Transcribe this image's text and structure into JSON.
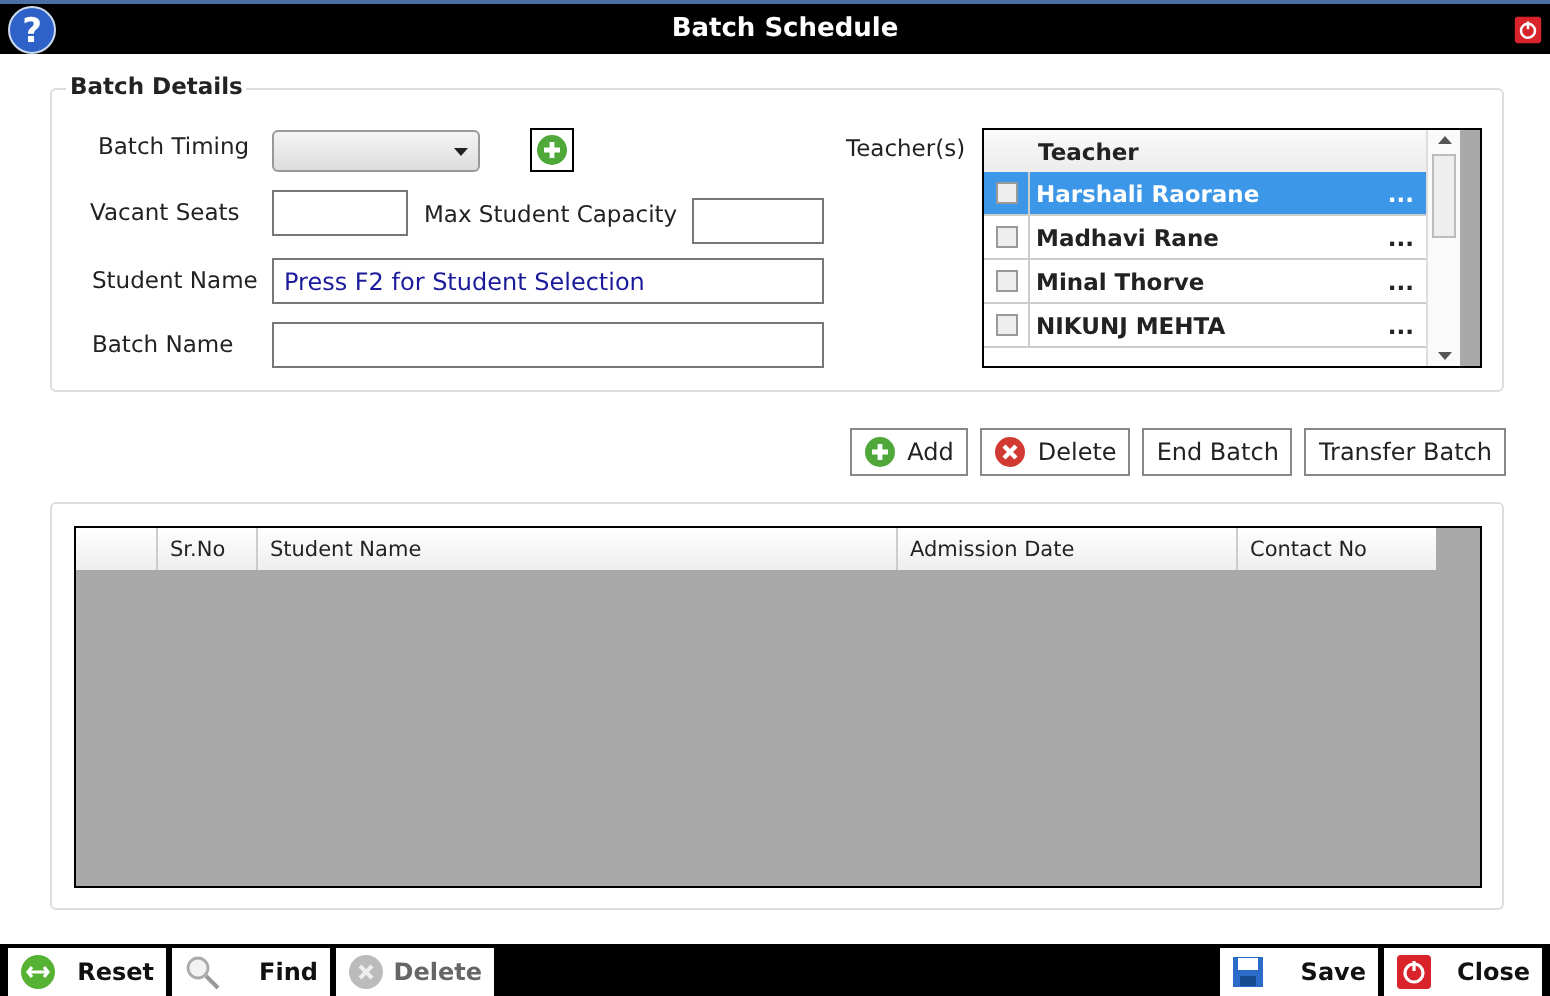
{
  "window": {
    "title": "Batch Schedule",
    "help": "?"
  },
  "batch_details": {
    "title": "Batch Details",
    "batch_timing": {
      "label": "Batch Timing"
    },
    "vacant_seats": {
      "label": "Vacant Seats"
    },
    "max_capacity": {
      "label": "Max Student Capacity"
    },
    "student_name": {
      "label": "Student Name",
      "placeholder": "Press F2 for Student Selection"
    },
    "batch_name": {
      "label": "Batch Name"
    },
    "teachers": {
      "label": "Teacher(s)",
      "column": "Teacher",
      "items": [
        {
          "name": "Harshali Raorane",
          "more": "...",
          "selected": true,
          "checked": false
        },
        {
          "name": "Madhavi Rane",
          "more": "...",
          "selected": false,
          "checked": false
        },
        {
          "name": "Minal Thorve",
          "more": "...",
          "selected": false,
          "checked": false
        },
        {
          "name": "NIKUNJ MEHTA",
          "more": "...",
          "selected": false,
          "checked": false
        }
      ]
    }
  },
  "actions": [
    {
      "label": "Add",
      "kind": "add"
    },
    {
      "label": "Delete",
      "kind": "delete"
    },
    {
      "label": "End Batch",
      "kind": "plain"
    },
    {
      "label": "Transfer Batch",
      "kind": "plain"
    }
  ],
  "students_table": {
    "columns": [
      "Sr.No",
      "Student Name",
      "Admission Date",
      "Contact No"
    ]
  },
  "footer": {
    "left": [
      {
        "label": "Reset",
        "kind": "reset",
        "disabled": false
      },
      {
        "label": "Find",
        "kind": "find",
        "disabled": false
      },
      {
        "label": "Delete",
        "kind": "delete",
        "disabled": true
      }
    ],
    "right": [
      {
        "label": "Save",
        "kind": "save",
        "disabled": false
      },
      {
        "label": "Close",
        "kind": "close",
        "disabled": false
      }
    ]
  }
}
